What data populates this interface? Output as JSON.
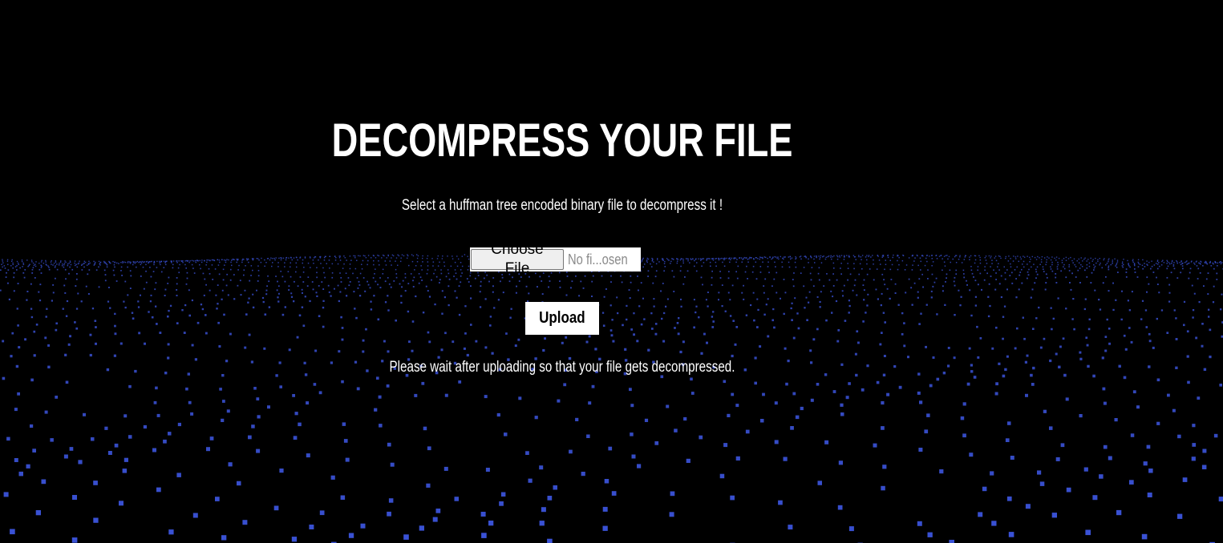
{
  "page": {
    "title": "DECOMPRESS YOUR FILE",
    "subtitle": "Select a huffman tree encoded binary file to decompress it !",
    "note": "Please wait after uploading so that your file gets decompressed."
  },
  "file_input": {
    "button_label": "Choose File",
    "status_text": "No fi...osen"
  },
  "upload": {
    "label": "Upload"
  },
  "background": {
    "color": "#000000",
    "particle_color": "#3a52d6"
  }
}
